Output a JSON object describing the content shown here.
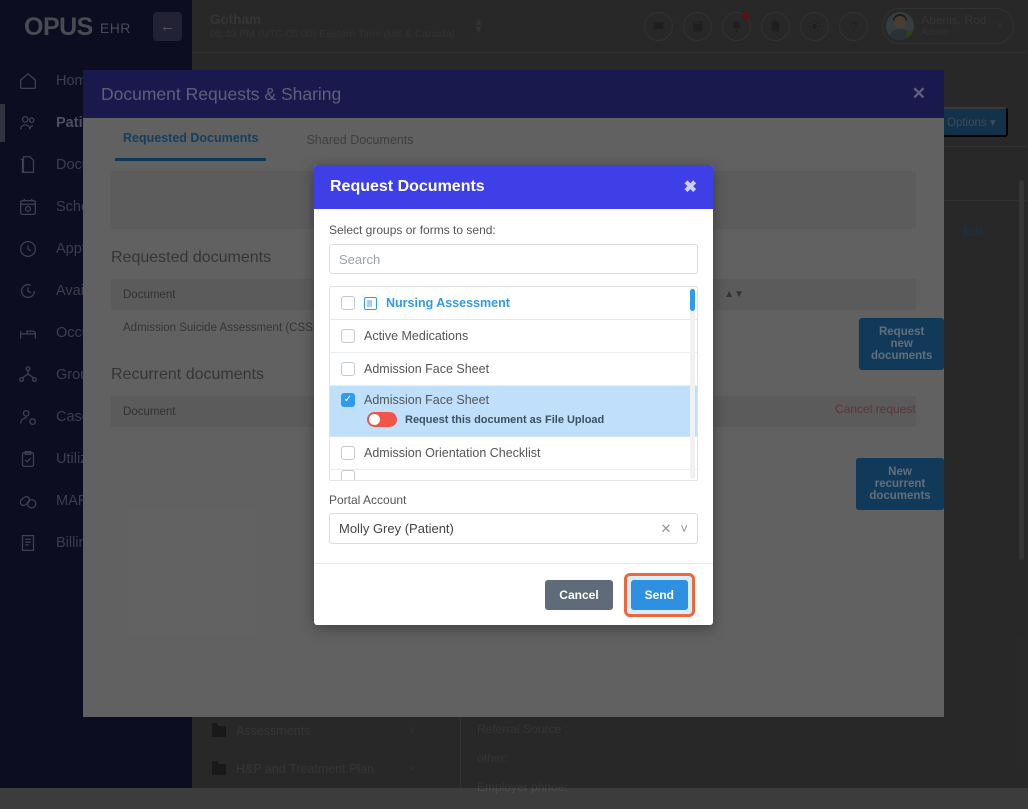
{
  "app": {
    "brand_logo": "OPUS",
    "brand_sub": "EHR",
    "collapse_icon": "arrow-left-icon"
  },
  "topbar": {
    "facility": "Gotham",
    "timezone": "05:49 PM (UTC-05:00) Eastern Time (US & Canada)",
    "sort_icon": "up-down-arrows-icon",
    "icons": [
      "chat-icon",
      "book-icon",
      "bell-icon",
      "clipboard-icon",
      "gear-icon",
      "help-icon"
    ],
    "user_name": "Abenis, Rod",
    "user_role": "Admin",
    "user_chevron": "chevron-down-icon"
  },
  "sidebar": {
    "items": [
      {
        "label": "Home",
        "icon": "home-icon",
        "active": false
      },
      {
        "label": "Patients",
        "icon": "patients-icon",
        "active": true
      },
      {
        "label": "Documents",
        "icon": "documents-icon",
        "active": false
      },
      {
        "label": "Schedule",
        "icon": "calendar-icon",
        "active": false
      },
      {
        "label": "Appt Requests",
        "icon": "clock-icon",
        "active": false
      },
      {
        "label": "Availability",
        "icon": "clock-dash-icon",
        "active": false
      },
      {
        "label": "Occupancy",
        "icon": "bed-icon",
        "active": false
      },
      {
        "label": "Group Notes",
        "icon": "group-icon",
        "active": false
      },
      {
        "label": "Case Load",
        "icon": "case-icon",
        "active": false
      },
      {
        "label": "Utilization",
        "icon": "checklist-icon",
        "active": false
      },
      {
        "label": "MARS",
        "icon": "pills-icon",
        "active": false
      },
      {
        "label": "Billing",
        "icon": "invoice-icon",
        "active": false
      }
    ]
  },
  "background": {
    "options_button": "Options",
    "options_caret": "caret-down-icon",
    "edit_link": "Edit",
    "tree_items": [
      {
        "label": "Assessments",
        "icon": "folder-icon",
        "chevron": "chevron-down-icon"
      },
      {
        "label": "H&P and Treatment Plan",
        "icon": "folder-icon",
        "chevron": "chevron-down-icon"
      }
    ],
    "detail_rows": [
      "Referral Source :",
      "other:",
      "Employer phnoe:"
    ]
  },
  "outer_modal": {
    "title": "Document Requests & Sharing",
    "close_icon": "close-icon",
    "tabs": [
      {
        "label": "Requested Documents",
        "active": true
      },
      {
        "label": "Shared Documents",
        "active": false
      }
    ],
    "requested_section": {
      "title": "Requested documents",
      "action_button": "Request new documents",
      "column_header": "Document",
      "sort_icon": "sort-icon",
      "rows": [
        {
          "document": "Admission Suicide Assessment (CSSRS)",
          "action": "Cancel request"
        }
      ]
    },
    "recurrent_section": {
      "title": "Recurrent documents",
      "action_button": "New recurrent documents",
      "column_header": "Document",
      "sort_icon": "sort-icon"
    }
  },
  "inner_dialog": {
    "title": "Request Documents",
    "close_icon": "close-icon",
    "instruction": "Select groups or forms to send:",
    "search_placeholder": "Search",
    "search_value": "",
    "documents": [
      {
        "label": "Nursing Assessment",
        "type": "group",
        "checked": false,
        "icon": "group-form-icon"
      },
      {
        "label": "Active Medications",
        "type": "form",
        "checked": false
      },
      {
        "label": "Admission Face Sheet",
        "type": "form",
        "checked": false
      },
      {
        "label": "Admission Face Sheet",
        "type": "form",
        "checked": true,
        "selected": true,
        "toggle": {
          "state": "off",
          "color": "#f2544a",
          "prefix": "Request this document as",
          "strong": "File Upload"
        }
      },
      {
        "label": "Admission Orientation Checklist",
        "type": "form",
        "checked": false
      }
    ],
    "portal_account_label": "Portal Account",
    "portal_account_value": "Molly Grey (Patient)",
    "portal_clear_icon": "clear-x-icon",
    "portal_chevron_icon": "chevron-down-icon",
    "cancel_label": "Cancel",
    "send_label": "Send",
    "send_focused": true,
    "colors": {
      "header_blue": "#3f3fe8",
      "accent_blue": "#2e9af0",
      "send_blue": "#2e90e0",
      "focus_ring": "#f0663c",
      "toggle_red": "#f2544a",
      "selected_row": "#bfdffa"
    }
  }
}
